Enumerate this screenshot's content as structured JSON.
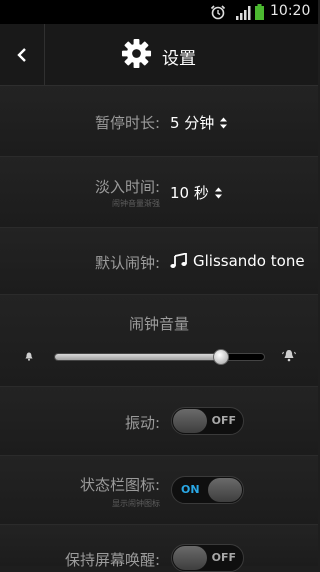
{
  "status_bar": {
    "time": "10:20",
    "icons": [
      "alarm-icon",
      "signal-icon",
      "battery-icon"
    ],
    "battery_color": "#4bb830"
  },
  "header": {
    "title": "设置",
    "back_icon": "chevron-left-icon",
    "title_icon": "gear-icon"
  },
  "settings": {
    "snooze": {
      "label": "暂停时长:",
      "value": "5 分钟"
    },
    "fade_in": {
      "label": "淡入时间:",
      "sublabel": "闹钟音量渐强",
      "value": "10 秒"
    },
    "default_alarm": {
      "label": "默认闹钟:",
      "value": "Glissando tone",
      "icon": "music-note-icon"
    },
    "alarm_volume": {
      "label": "闹钟音量",
      "level": 0.79
    },
    "vibrate": {
      "label": "振动:",
      "state": "OFF"
    },
    "status_bar_icon": {
      "label": "状态栏图标:",
      "sublabel": "显示闹钟图标",
      "state": "ON"
    },
    "keep_awake": {
      "label": "保持屏幕唤醒:",
      "state": "OFF"
    }
  },
  "colors": {
    "accent_on": "#2aa8e6"
  }
}
